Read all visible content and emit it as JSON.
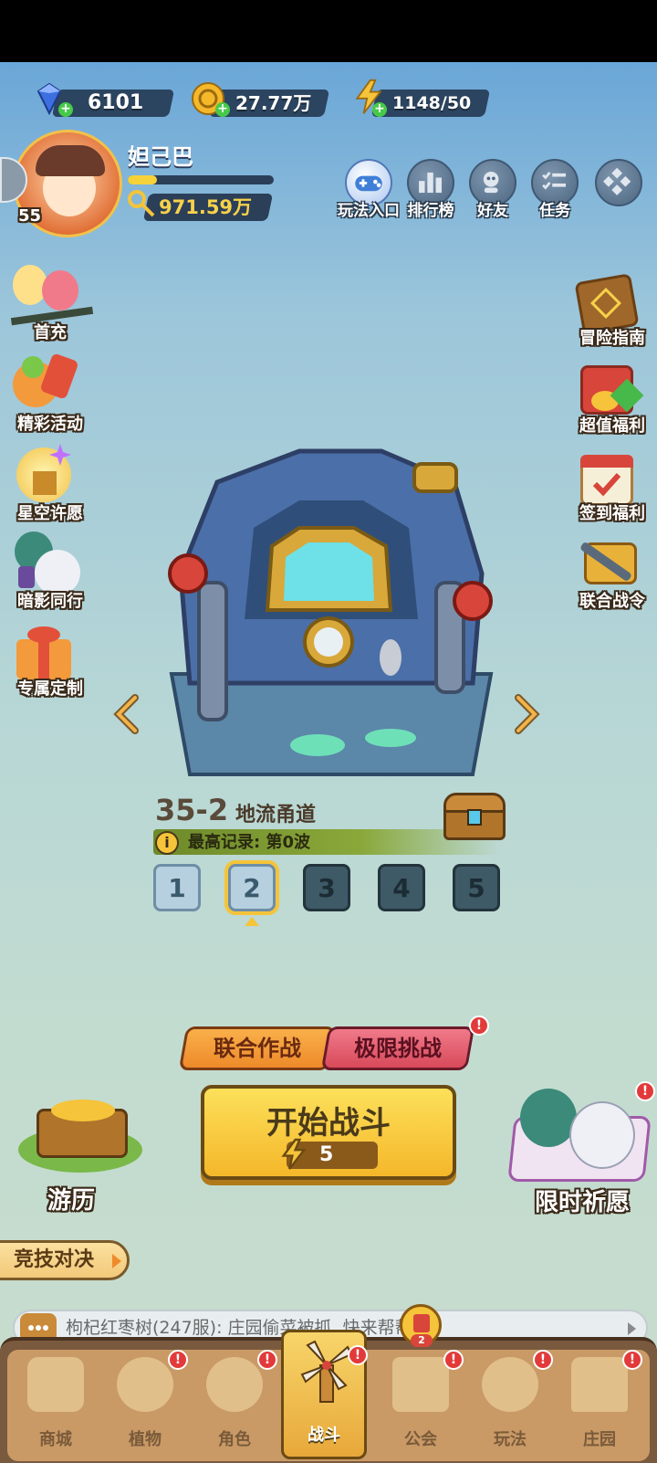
{
  "currencies": {
    "gems": "6101",
    "coins": "27.77万",
    "energy": "1148/50"
  },
  "player": {
    "name": "妲己巴",
    "level": "55",
    "power": "971.59万",
    "exp_progress": 0.2
  },
  "top_menu": [
    {
      "label": "玩法入口",
      "icon": "gamepad-icon"
    },
    {
      "label": "排行榜",
      "icon": "leaderboard-icon"
    },
    {
      "label": "好友",
      "icon": "friends-icon"
    },
    {
      "label": "任务",
      "icon": "tasks-icon"
    },
    {
      "label": "",
      "icon": "more-icon"
    }
  ],
  "left_menu": [
    {
      "label": "首充",
      "icon": "first-recharge-icon"
    },
    {
      "label": "精彩活动",
      "icon": "events-icon"
    },
    {
      "label": "星空许愿",
      "icon": "starry-wish-icon"
    },
    {
      "label": "暗影同行",
      "icon": "shadow-companion-icon"
    },
    {
      "label": "专属定制",
      "icon": "gift-box-icon"
    }
  ],
  "right_menu": [
    {
      "label": "冒险指南",
      "icon": "adventure-guide-icon"
    },
    {
      "label": "超值福利",
      "icon": "value-welfare-icon"
    },
    {
      "label": "签到福利",
      "icon": "checkin-calendar-icon"
    },
    {
      "label": "联合战令",
      "icon": "battle-pass-icon"
    }
  ],
  "stage": {
    "id": "35-2",
    "name": "地流甬道",
    "record": "最高记录: 第0波",
    "waves": [
      "1",
      "2",
      "3",
      "4",
      "5"
    ],
    "selected_wave": "2"
  },
  "modes": {
    "coop": "联合作战",
    "challenge": "极限挑战"
  },
  "start": {
    "label": "开始战斗",
    "cost": "5"
  },
  "left_feature": {
    "label": "游历"
  },
  "right_feature": {
    "label": "限时祈愿"
  },
  "arena": {
    "label": "竞技对决"
  },
  "chat": {
    "message": "枸杞红枣树(247服): 庄园偷菜被抓, 快来帮帮我"
  },
  "guild_badge_count": "2",
  "bottom_nav": [
    {
      "label": "商城",
      "icon": "shop-icon",
      "alert": false
    },
    {
      "label": "植物",
      "icon": "plant-icon",
      "alert": true
    },
    {
      "label": "角色",
      "icon": "character-icon",
      "alert": true
    },
    {
      "label": "战斗",
      "icon": "windmill-battle-icon",
      "alert": true,
      "active": true
    },
    {
      "label": "公会",
      "icon": "guild-icon",
      "alert": true
    },
    {
      "label": "玩法",
      "icon": "gameplay-icon",
      "alert": true
    },
    {
      "label": "庄园",
      "icon": "manor-icon",
      "alert": true
    }
  ],
  "colors": {
    "accent_yellow": "#f5c43a",
    "orange": "#f39a3c",
    "red": "#e05a6a",
    "nav_bg": "#7a5a3e"
  }
}
